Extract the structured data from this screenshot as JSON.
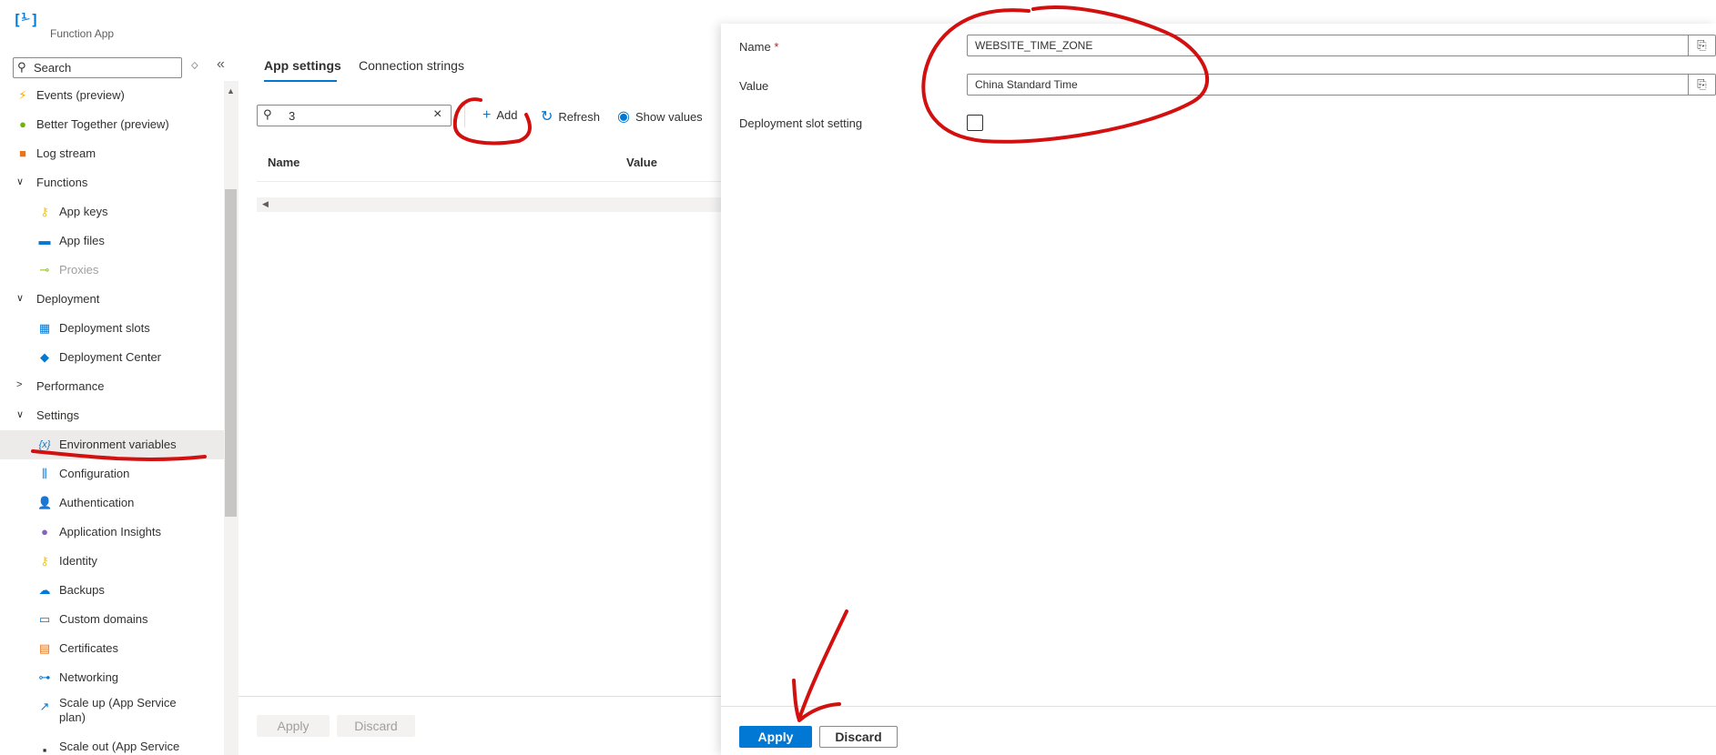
{
  "app": {
    "logo": "[⅟]",
    "subtitle": "Function App"
  },
  "sidebar": {
    "search_placeholder": "Search",
    "items": [
      {
        "label": "Events (preview)",
        "icon": "⚡",
        "icon_name": "lightning-icon",
        "color": "#f7a700"
      },
      {
        "label": "Better Together (preview)",
        "icon": "●",
        "icon_name": "lightbulb-icon",
        "color": "#6bb700"
      },
      {
        "label": "Log stream",
        "icon": "■",
        "icon_name": "log-stream-icon",
        "color": "#e8741c"
      },
      {
        "label": "Functions",
        "chevron": "∨"
      },
      {
        "label": "App keys",
        "icon": "⚷",
        "icon_name": "key-icon",
        "color": "#f2c811"
      },
      {
        "label": "App files",
        "icon": "▬",
        "icon_name": "app-files-icon",
        "color": "#0078d4"
      },
      {
        "label": "Proxies",
        "icon": "⊸",
        "icon_name": "proxies-icon",
        "color": "#8cbd18"
      },
      {
        "label": "Deployment",
        "chevron": "∨"
      },
      {
        "label": "Deployment slots",
        "icon": "▦",
        "icon_name": "deployment-slots-icon",
        "color": "#0078d4"
      },
      {
        "label": "Deployment Center",
        "icon": "◆",
        "icon_name": "deployment-center-icon",
        "color": "#0078d4"
      },
      {
        "label": "Performance",
        "chevron": ">"
      },
      {
        "label": "Settings",
        "chevron": "∨"
      },
      {
        "label": "Environment variables",
        "icon": "{x}",
        "icon_name": "environment-variables-icon",
        "color": "#0078d4"
      },
      {
        "label": "Configuration",
        "icon": "⫼",
        "icon_name": "configuration-icon",
        "color": "#0078d4"
      },
      {
        "label": "Authentication",
        "icon": "👤",
        "icon_name": "authentication-icon",
        "color": "#0078d4"
      },
      {
        "label": "Application Insights",
        "icon": "●",
        "icon_name": "application-insights-icon",
        "color": "#8661c5"
      },
      {
        "label": "Identity",
        "icon": "⚷",
        "icon_name": "identity-icon",
        "color": "#f2c811"
      },
      {
        "label": "Backups",
        "icon": "☁",
        "icon_name": "backups-icon",
        "color": "#0078d4"
      },
      {
        "label": "Custom domains",
        "icon": "▭",
        "icon_name": "custom-domains-icon",
        "color": "#0078d4"
      },
      {
        "label": "Certificates",
        "icon": "▤",
        "icon_name": "certificates-icon",
        "color": "#e8741c"
      },
      {
        "label": "Networking",
        "icon": "⊶",
        "icon_name": "networking-icon",
        "color": "#0078d4"
      },
      {
        "label": "Scale up (App Service plan)",
        "icon": "↗",
        "icon_name": "scale-up-icon",
        "color": "#0078d4"
      },
      {
        "label": "Scale out (App Service",
        "icon": "▪",
        "icon_name": "scale-out-icon",
        "color": "#323130"
      }
    ]
  },
  "main": {
    "tabs": [
      "App settings",
      "Connection strings"
    ],
    "filter_value": "3",
    "toolbar": {
      "add": "Add",
      "refresh": "Refresh",
      "show_values": "Show values"
    },
    "columns": [
      "Name",
      "Value"
    ],
    "footer": {
      "apply": "Apply",
      "discard": "Discard"
    }
  },
  "panel": {
    "name_label": "Name",
    "required_mark": "*",
    "name_value": "WEBSITE_TIME_ZONE",
    "value_label": "Value",
    "value_value": "China Standard Time",
    "slot_label": "Deployment slot setting",
    "apply": "Apply",
    "discard": "Discard"
  },
  "colors": {
    "accent": "#0078d4",
    "annotation": "#d31010"
  }
}
